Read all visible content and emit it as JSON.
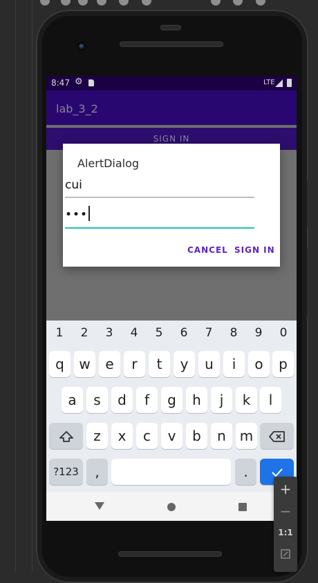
{
  "status_bar": {
    "time": "8:47",
    "network": "LTE",
    "icons": [
      "settings-icon",
      "sd-card-icon",
      "signal-icon",
      "battery-icon"
    ]
  },
  "app_bar": {
    "title": "lab_3_2"
  },
  "main": {
    "sign_in_button": "SIGN IN"
  },
  "dialog": {
    "title": "AlertDialog",
    "username_value": "cui",
    "password_value": "•••",
    "cancel_label": "CANCEL",
    "signin_label": "SIGN IN",
    "accent_color": "#5a1fc8",
    "focus_color": "#1fc3b4"
  },
  "keyboard": {
    "number_row": [
      "1",
      "2",
      "3",
      "4",
      "5",
      "6",
      "7",
      "8",
      "9",
      "0"
    ],
    "row1": [
      "q",
      "w",
      "e",
      "r",
      "t",
      "y",
      "u",
      "i",
      "o",
      "p"
    ],
    "row2": [
      "a",
      "s",
      "d",
      "f",
      "g",
      "h",
      "j",
      "k",
      "l"
    ],
    "row3": [
      "z",
      "x",
      "c",
      "v",
      "b",
      "n",
      "m"
    ],
    "symbols_label": "?123",
    "comma_label": ",",
    "period_label": ".",
    "shift_icon": "shift-icon",
    "backspace_icon": "backspace-icon",
    "enter_icon": "checkmark-icon"
  },
  "nav_bar": {
    "icons": [
      "back-icon",
      "home-icon",
      "recents-icon"
    ]
  },
  "emulator_panel": {
    "plus": "+",
    "minus": "−",
    "ratio": "1:1"
  },
  "colors": {
    "status_bar": "#1c0044",
    "app_bar": "#280870",
    "scrim": "#6f6f6f"
  }
}
